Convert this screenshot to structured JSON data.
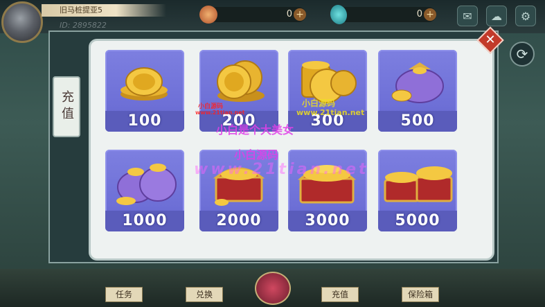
{
  "player": {
    "name": "旧马桩提亚5",
    "uid": "ID: 2895822"
  },
  "currencies": [
    {
      "icon": "gold-coin-icon",
      "value": "0",
      "add_label": "+"
    },
    {
      "icon": "diamond-icon",
      "value": "0",
      "add_label": "+"
    }
  ],
  "top_buttons": [
    "mail-icon",
    "chat-icon",
    "gear-icon"
  ],
  "side_tab": {
    "label": "充值"
  },
  "close_label": "✕",
  "refresh_label": "⟳",
  "recharge_options": [
    {
      "amount": "100",
      "art": "small-coin-stack-icon"
    },
    {
      "amount": "200",
      "art": "coin-stack-icon"
    },
    {
      "amount": "300",
      "art": "large-coin-stack-icon"
    },
    {
      "amount": "500",
      "art": "coin-bag-icon"
    },
    {
      "amount": "1000",
      "art": "coin-bags-icon"
    },
    {
      "amount": "2000",
      "art": "treasure-chest-icon"
    },
    {
      "amount": "3000",
      "art": "treasure-chest-large-icon"
    },
    {
      "amount": "5000",
      "art": "treasure-chests-icon"
    }
  ],
  "bottom_nav": [
    "任务",
    "兑换",
    "充值",
    "保险箱"
  ],
  "watermarks": {
    "w1": "小白是个大美女",
    "w2": "小白源码",
    "w3": "www.21tian.net",
    "w4": "小白源码",
    "w5": "www.21tian.net",
    "w6": "小白源码",
    "w7": "www.21tian.net"
  },
  "colors": {
    "card": "#6d6fd6",
    "amount_band": "#5a5cbb",
    "close": "#c23a2a"
  }
}
